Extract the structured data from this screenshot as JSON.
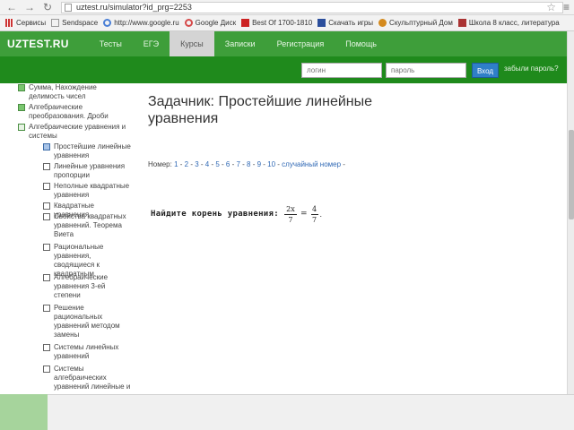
{
  "browser": {
    "url": "uztest.ru/simulator?id_prg=2253",
    "bookmarks": [
      "Сервисы",
      "Sendspace",
      "http://www.google.ru",
      "Google Диск",
      "Best Of 1700-1810",
      "Скачать игры",
      "Скульптурный Дом",
      "Школа 8 класс, литература"
    ]
  },
  "site": {
    "logo": "UZTEST.RU",
    "nav": [
      "Тесты",
      "ЕГЭ",
      "Курсы",
      "Записки",
      "Регистрация",
      "Помощь"
    ],
    "login_placeholder": "логин",
    "password_placeholder": "пароль",
    "login_button": "Вход",
    "register_link": "забыли пароль?"
  },
  "sidebar": {
    "items": [
      {
        "label": "Сумма, Нахождение делимость чисел",
        "style": "green"
      },
      {
        "label": "Алгебраические преобразования. Дроби",
        "style": "green"
      },
      {
        "label": "Алгебраические уравнения и системы",
        "style": "open"
      },
      {
        "label": "Простейшие линейные уравнения",
        "style": "doc"
      },
      {
        "label": "Линейные уравнения пропорции",
        "style": "plain"
      },
      {
        "label": "Неполные квадратные уравнения",
        "style": "plain"
      },
      {
        "label": "Квадратные уравнения",
        "style": "plain"
      },
      {
        "label": "Свойства квадратных уравнений. Теорема Виета",
        "style": "plain"
      },
      {
        "label": "Рациональные уравнения, сводящиеся к квадратным",
        "style": "plain"
      },
      {
        "label": "Алгебраические уравнения 3-ей степени",
        "style": "plain"
      },
      {
        "label": "Решение рациональных уравнений методом замены",
        "style": "plain"
      },
      {
        "label": "Системы линейных уравнений",
        "style": "plain"
      },
      {
        "label": "Системы алгебраических уравнений линейные и",
        "style": "plain"
      }
    ]
  },
  "main": {
    "title": "Задачник: Простейшие линейные уравнения",
    "numbers_prefix": "Номер: ",
    "numbers": [
      "1",
      "2",
      "3",
      "4",
      "5",
      "6",
      "7",
      "8",
      "9",
      "10"
    ],
    "random_link": "случайный номер",
    "task_text": "Найдите корень уравнения:",
    "lhs_num": "2x",
    "lhs_den": "7",
    "rhs_num": "4",
    "rhs_den": "7"
  }
}
